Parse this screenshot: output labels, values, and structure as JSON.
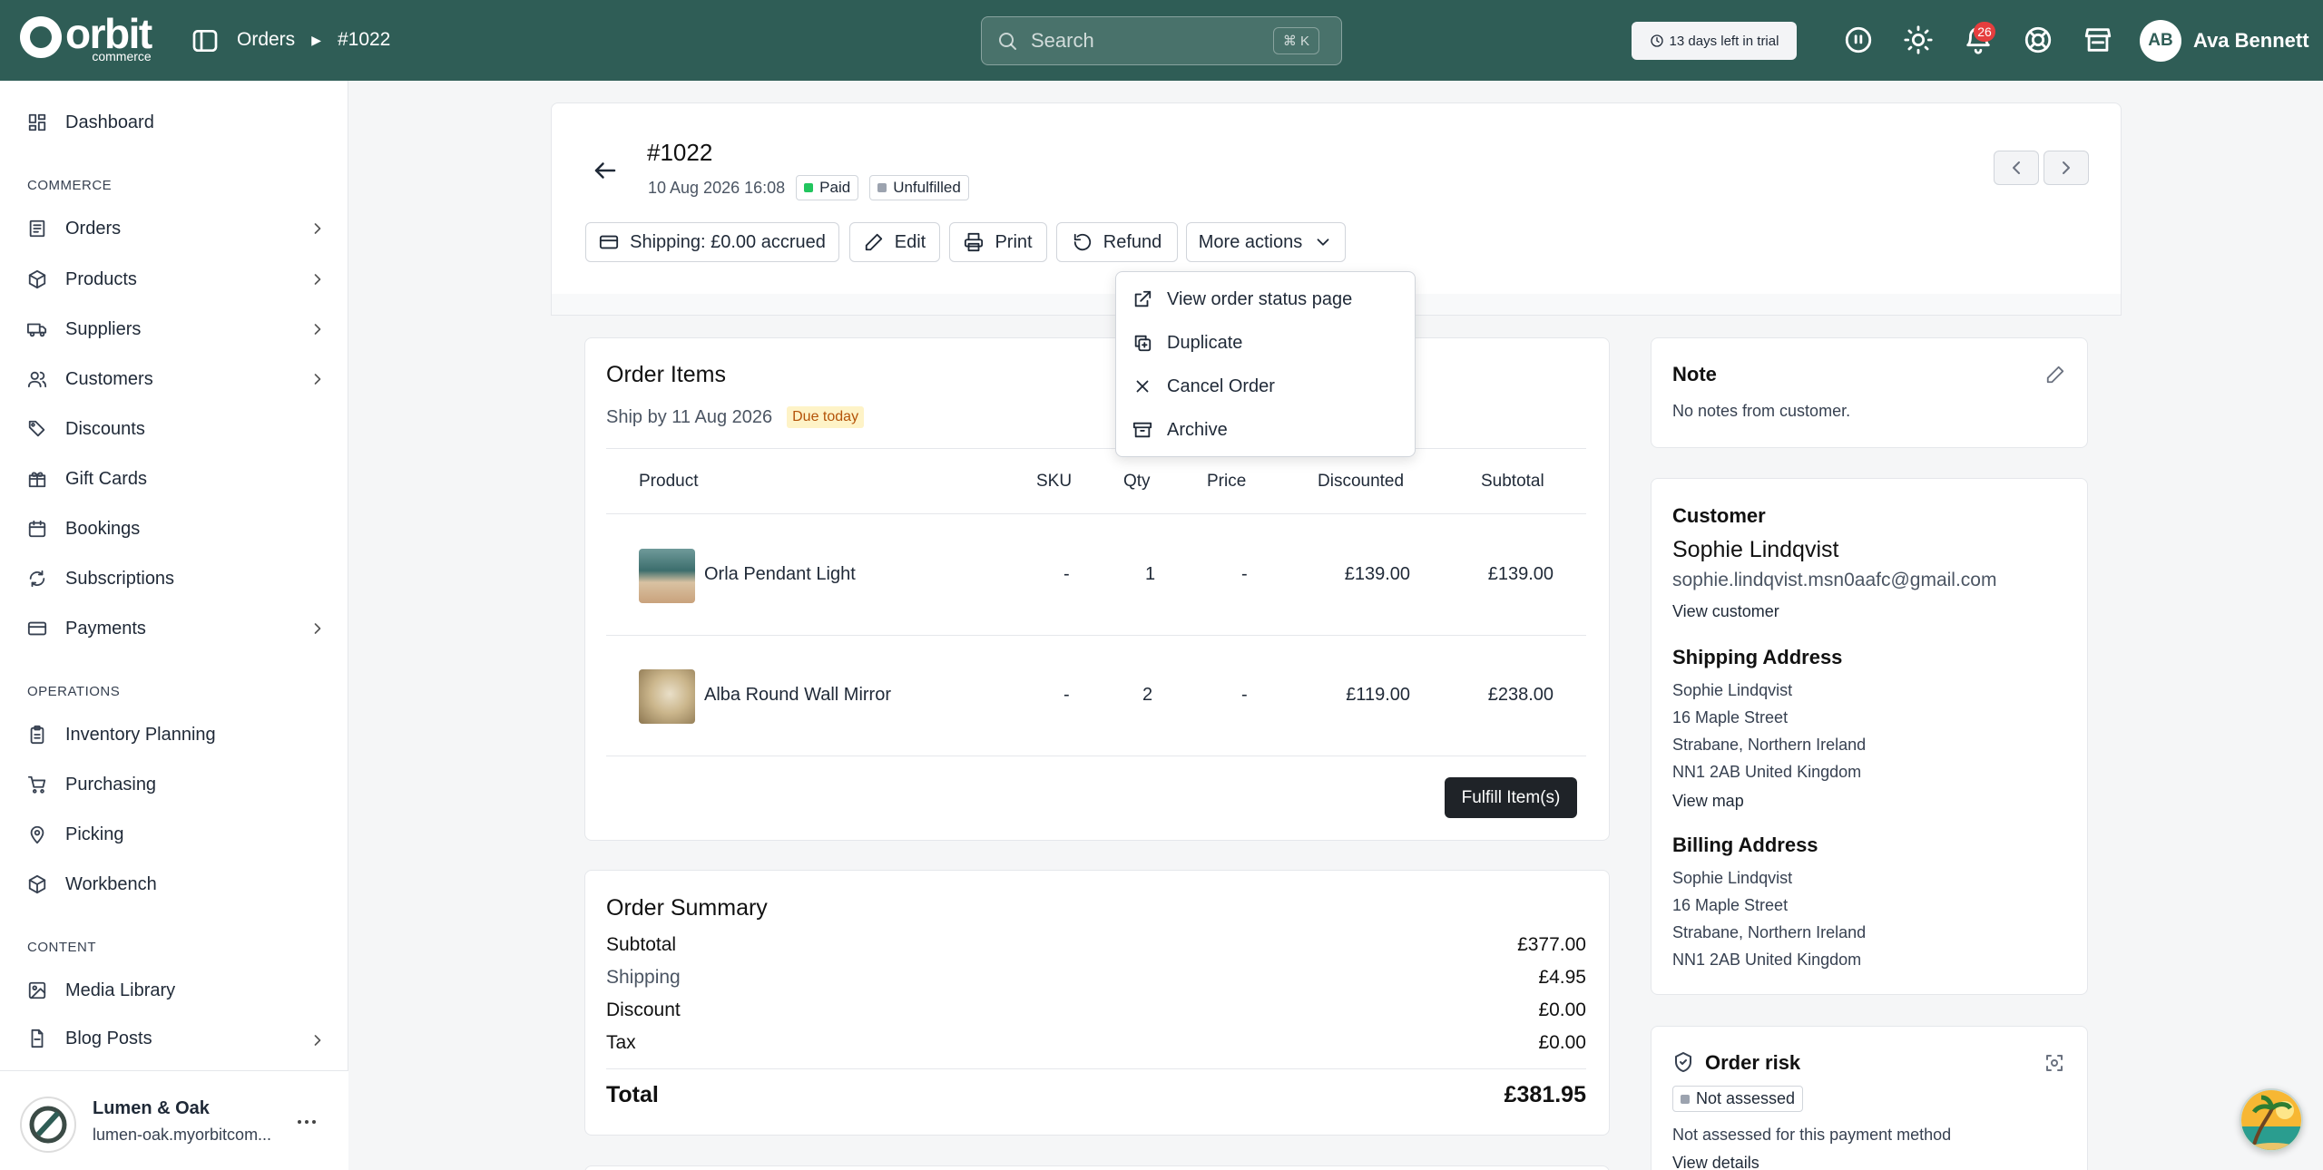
{
  "topbar": {
    "logo_word": "orbit",
    "logo_sub": "commerce",
    "breadcrumb": [
      "Orders",
      "#1022"
    ],
    "search_placeholder": "Search",
    "search_shortcut": "⌘ K",
    "trial_text": "13 days left in trial",
    "notification_count": "26",
    "user_initials": "AB",
    "user_name": "Ava Bennett"
  },
  "sidebar": {
    "dashboard": "Dashboard",
    "commerce_heading": "COMMERCE",
    "commerce_items": [
      "Orders",
      "Products",
      "Suppliers",
      "Customers",
      "Discounts",
      "Gift Cards",
      "Bookings",
      "Subscriptions",
      "Payments"
    ],
    "operations_heading": "OPERATIONS",
    "operations_items": [
      "Inventory Planning",
      "Purchasing",
      "Picking",
      "Workbench"
    ],
    "content_heading": "CONTENT",
    "content_items": [
      "Media Library",
      "Blog Posts"
    ],
    "store_name": "Lumen & Oak",
    "store_url": "lumen-oak.myorbitcom..."
  },
  "order": {
    "number": "#1022",
    "datetime": "10 Aug 2026 16:08",
    "payment_status": "Paid",
    "fulfillment_status": "Unfulfilled",
    "colors": {
      "paid": "#22c55e",
      "unfulfilled": "#9ca3af",
      "due": "#b45309",
      "due_bg": "#fef3c7",
      "brand": "#2f5d56"
    }
  },
  "actions": {
    "shipping": "Shipping: £0.00 accrued",
    "edit": "Edit",
    "print": "Print",
    "refund": "Refund",
    "more": "More actions"
  },
  "more_menu": [
    "View order status page",
    "Duplicate",
    "Cancel Order",
    "Archive"
  ],
  "order_items": {
    "title": "Order Items",
    "ship_by": "Ship by 11 Aug 2026",
    "due_badge": "Due today",
    "columns": [
      "Product",
      "SKU",
      "Qty",
      "Price",
      "Discounted",
      "Subtotal"
    ],
    "rows": [
      {
        "product": "Orla Pendant Light",
        "sku": "-",
        "qty": "1",
        "price": "-",
        "discounted": "£139.00",
        "subtotal": "£139.00"
      },
      {
        "product": "Alba Round Wall Mirror",
        "sku": "-",
        "qty": "2",
        "price": "-",
        "discounted": "£119.00",
        "subtotal": "£238.00"
      }
    ],
    "fulfill_button": "Fulfill Item(s)"
  },
  "summary": {
    "title": "Order Summary",
    "rows": [
      {
        "label": "Subtotal",
        "value": "£377.00"
      },
      {
        "label": "Shipping",
        "value": "£4.95"
      },
      {
        "label": "Discount",
        "value": "£0.00"
      },
      {
        "label": "Tax",
        "value": "£0.00"
      }
    ],
    "total_label": "Total",
    "total_value": "£381.95"
  },
  "note": {
    "title": "Note",
    "text": "No notes from customer."
  },
  "customer": {
    "title": "Customer",
    "name": "Sophie Lindqvist",
    "email": "sophie.lindqvist.msn0aafc@gmail.com",
    "view_link": "View customer",
    "shipping_title": "Shipping Address",
    "shipping_lines": [
      "Sophie Lindqvist",
      "16 Maple Street",
      "Strabane, Northern Ireland",
      "NN1 2AB United Kingdom"
    ],
    "view_map": "View map",
    "billing_title": "Billing Address",
    "billing_lines": [
      "Sophie Lindqvist",
      "16 Maple Street",
      "Strabane, Northern Ireland",
      "NN1 2AB United Kingdom"
    ]
  },
  "risk": {
    "title": "Order risk",
    "badge": "Not assessed",
    "text": "Not assessed for this payment method",
    "link": "View details"
  }
}
